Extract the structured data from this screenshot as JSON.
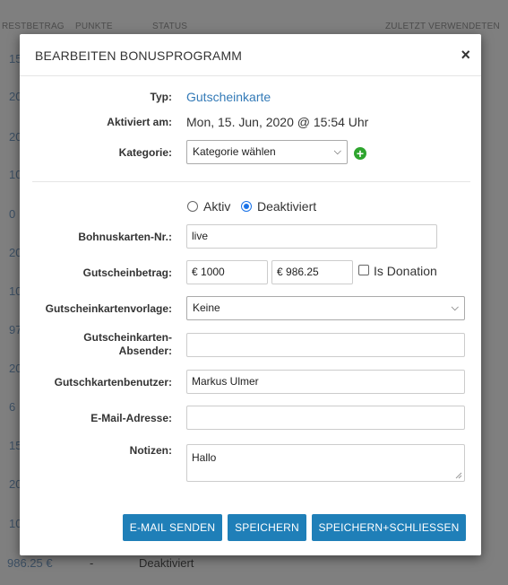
{
  "background": {
    "columns": [
      "RESTBETRAG",
      "PUNKTE",
      "STATUS",
      "ZULETZT VERWENDETEN"
    ],
    "left_values": [
      "15",
      "20",
      "20",
      "10",
      "0",
      "20",
      "10",
      "97",
      "20",
      "6",
      "15",
      "20",
      "10"
    ],
    "footer": {
      "amount": "986.25 €",
      "points": "-",
      "status": "Deaktiviert"
    }
  },
  "modal": {
    "title": "BEARBEITEN BONUSPROGRAMM",
    "close": "×",
    "typ_label": "Typ:",
    "typ_value": "Gutscheinkarte",
    "activated_label": "Aktiviert am:",
    "activated_value": "Mon, 15. Jun, 2020 @ 15:54 Uhr",
    "category_label": "Kategorie:",
    "category_value": "Kategorie wählen",
    "status_options": {
      "active": "Aktiv",
      "deactivated": "Deaktiviert",
      "selected": "Deaktiviert"
    },
    "card_number_label": "Bohnuskarten-Nr.:",
    "card_number_value": "live",
    "amount_label": "Gutscheinbetrag:",
    "currency": "€",
    "amount_initial": "1000",
    "amount_remaining": "986.25",
    "donation_label": "Is Donation",
    "template_label": "Gutscheinkartenvorlage:",
    "template_value": "Keine",
    "sender_label_1": "Gutscheinkarten-",
    "sender_label_2": "Absender:",
    "sender_value": "",
    "user_label": "Gutschkartenbenutzer:",
    "user_value": "Markus Ulmer",
    "email_label": "E-Mail-Adresse:",
    "email_value": "",
    "notes_label": "Notizen:",
    "notes_value": "Hallo",
    "buttons": {
      "email": "E-MAIL SENDEN",
      "save": "SPEICHERN",
      "save_close": "SPEICHERN+SCHLIESSEN"
    }
  },
  "colors": {
    "link": "#337ab7",
    "button": "#1f7fb8",
    "add": "#2ea52e"
  }
}
